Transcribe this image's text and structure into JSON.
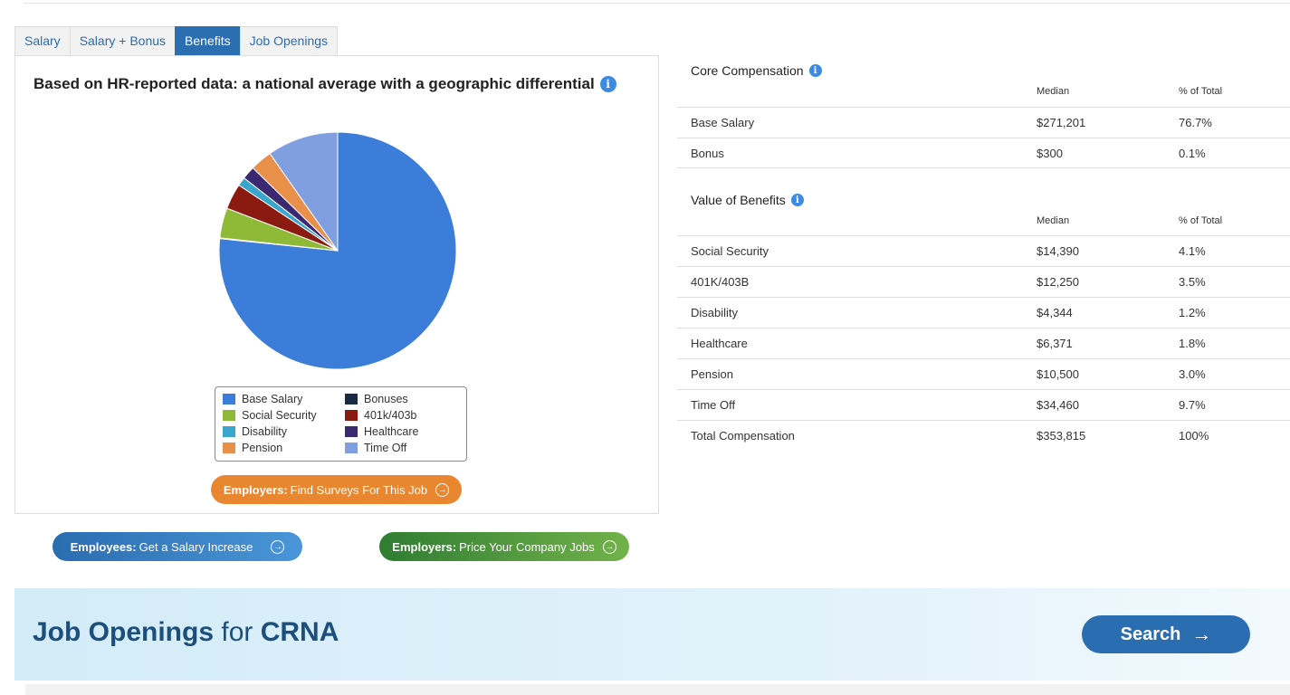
{
  "tabs": [
    "Salary",
    "Salary + Bonus",
    "Benefits",
    "Job Openings"
  ],
  "active_tab": "Benefits",
  "chart_heading": "Based on HR-reported data: a national average with a geographic differential",
  "chart_data": {
    "type": "pie",
    "title": "",
    "slices": [
      {
        "label": "Base Salary",
        "value": 76.7,
        "color": "#3b7dd8"
      },
      {
        "label": "Bonuses",
        "value": 0.1,
        "color": "#1a2a44"
      },
      {
        "label": "Social Security",
        "value": 4.1,
        "color": "#8fba38"
      },
      {
        "label": "401k/403b",
        "value": 3.5,
        "color": "#8b1a10"
      },
      {
        "label": "Disability",
        "value": 1.2,
        "color": "#3aa6cc"
      },
      {
        "label": "Healthcare",
        "value": 1.8,
        "color": "#3a2870"
      },
      {
        "label": "Pension",
        "value": 3.0,
        "color": "#e8904a"
      },
      {
        "label": "Time Off",
        "value": 9.7,
        "color": "#7f9fe0"
      }
    ]
  },
  "legend": [
    {
      "label": "Base Salary",
      "color": "#3b7dd8"
    },
    {
      "label": "Bonuses",
      "color": "#1a2a44"
    },
    {
      "label": "Social Security",
      "color": "#8fba38"
    },
    {
      "label": "401k/403b",
      "color": "#8b1a10"
    },
    {
      "label": "Disability",
      "color": "#3aa6cc"
    },
    {
      "label": "Healthcare",
      "color": "#3a2870"
    },
    {
      "label": "Pension",
      "color": "#e8904a"
    },
    {
      "label": "Time Off",
      "color": "#7f9fe0"
    }
  ],
  "buttons": {
    "employers_surveys": {
      "strong": "Employers:",
      "text": "Find Surveys For This Job"
    },
    "employees_increase": {
      "strong": "Employees:",
      "text": "Get a Salary Increase"
    },
    "employers_price": {
      "strong": "Employers:",
      "text": "Price Your Company Jobs"
    }
  },
  "core": {
    "title": "Core Compensation",
    "col_median": "Median",
    "col_pct": "% of Total",
    "rows": [
      {
        "label": "Base Salary",
        "median": "$271,201",
        "pct": "76.7%"
      },
      {
        "label": "Bonus",
        "median": "$300",
        "pct": "0.1%"
      }
    ]
  },
  "benefits": {
    "title": "Value of Benefits",
    "col_median": "Median",
    "col_pct": "% of Total",
    "rows": [
      {
        "label": "Social Security",
        "median": "$14,390",
        "pct": "4.1%"
      },
      {
        "label": "401K/403B",
        "median": "$12,250",
        "pct": "3.5%"
      },
      {
        "label": "Disability",
        "median": "$4,344",
        "pct": "1.2%"
      },
      {
        "label": "Healthcare",
        "median": "$6,371",
        "pct": "1.8%"
      },
      {
        "label": "Pension",
        "median": "$10,500",
        "pct": "3.0%"
      },
      {
        "label": "Time Off",
        "median": "$34,460",
        "pct": "9.7%"
      },
      {
        "label": "Total Compensation",
        "median": "$353,815",
        "pct": "100%"
      }
    ]
  },
  "banner": {
    "title_1": "Job Openings",
    "title_2": "for",
    "title_3": "CRNA",
    "search_label": "Search"
  }
}
